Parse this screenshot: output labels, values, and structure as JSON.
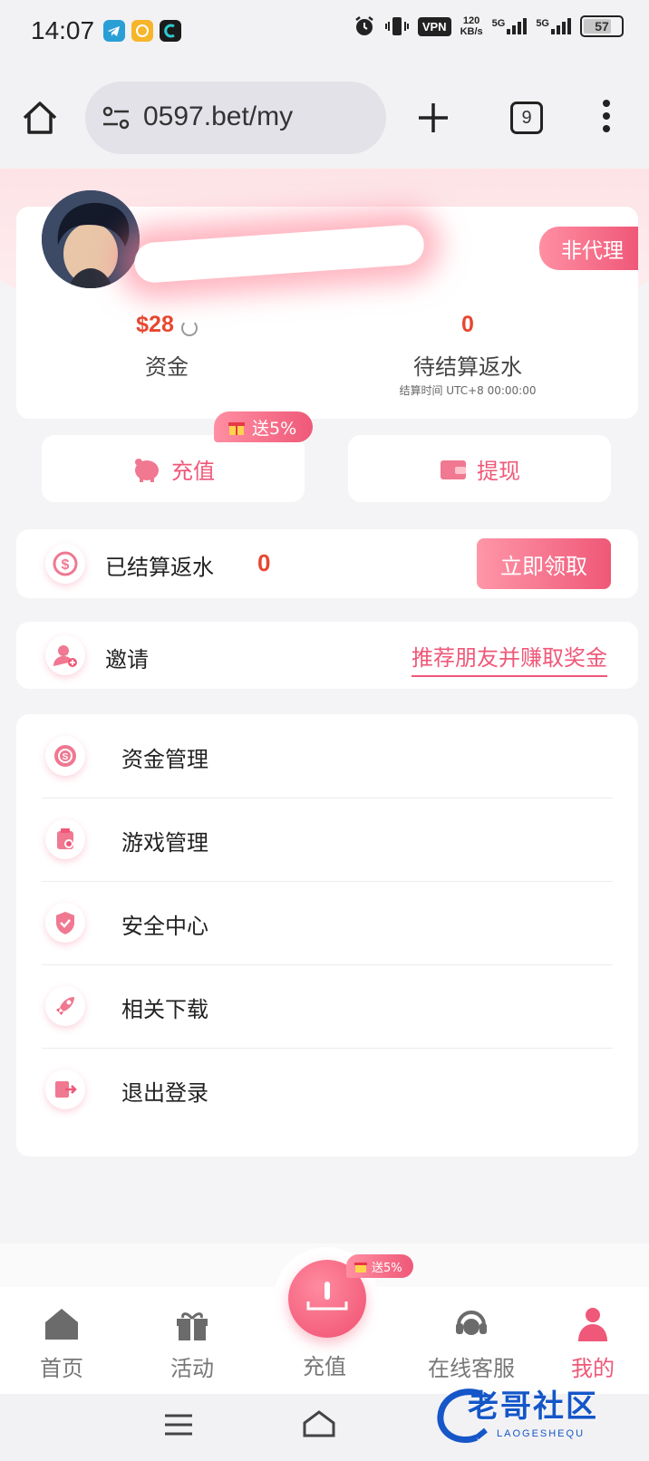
{
  "status_bar": {
    "time": "14:07",
    "vpn": "VPN",
    "speed_value": "120",
    "speed_unit": "KB/s",
    "network1": "5G",
    "network2": "5G",
    "battery": "57"
  },
  "browser": {
    "url": "0597.bet/my",
    "tab_count": "9"
  },
  "profile": {
    "badge": "非代理",
    "balance_value": "$28",
    "balance_label": "资金",
    "pending_rebate_value": "0",
    "pending_rebate_label": "待结算返水",
    "settlement_time": "结算时间 UTC+8 00:00:00"
  },
  "actions": {
    "deposit": "充值",
    "withdraw": "提现",
    "promo": "送5%"
  },
  "settled_rebate": {
    "label": "已结算返水",
    "value": "0",
    "claim_button": "立即领取"
  },
  "invite": {
    "label": "邀请",
    "link": "推荐朋友并赚取奖金"
  },
  "menu": [
    {
      "label": "资金管理",
      "icon": "money-icon"
    },
    {
      "label": "游戏管理",
      "icon": "game-manage-icon"
    },
    {
      "label": "安全中心",
      "icon": "shield-icon"
    },
    {
      "label": "相关下载",
      "icon": "rocket-icon"
    },
    {
      "label": "退出登录",
      "icon": "logout-icon"
    }
  ],
  "tabbar": {
    "home": "首页",
    "activity": "活动",
    "deposit": "充值",
    "support": "在线客服",
    "mine": "我的",
    "promo": "送5%",
    "accent": "#ef5878"
  },
  "watermark": {
    "title": "老哥社区",
    "subtitle": "LAOGESHEQU"
  }
}
